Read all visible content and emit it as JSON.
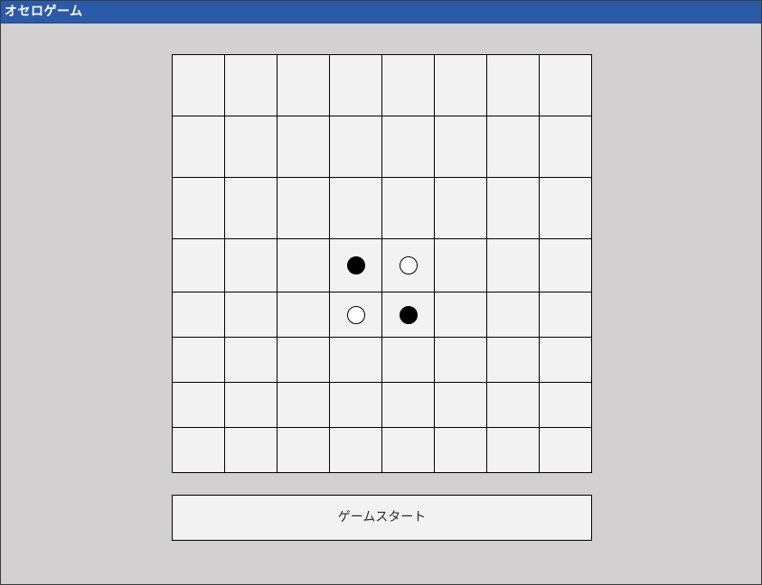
{
  "window": {
    "title": "オセロゲーム"
  },
  "board": {
    "rows": 8,
    "cols": 8,
    "stones": [
      {
        "row": 3,
        "col": 3,
        "color": "black"
      },
      {
        "row": 3,
        "col": 4,
        "color": "white"
      },
      {
        "row": 4,
        "col": 3,
        "color": "white"
      },
      {
        "row": 4,
        "col": 4,
        "color": "black"
      }
    ]
  },
  "controls": {
    "start_label": "ゲームスタート"
  },
  "colors": {
    "titlebar": "#2b5ba8",
    "background": "#d2d0d1",
    "cell": "#f2f2f2",
    "black_stone": "#000000",
    "white_stone": "#ffffff"
  }
}
